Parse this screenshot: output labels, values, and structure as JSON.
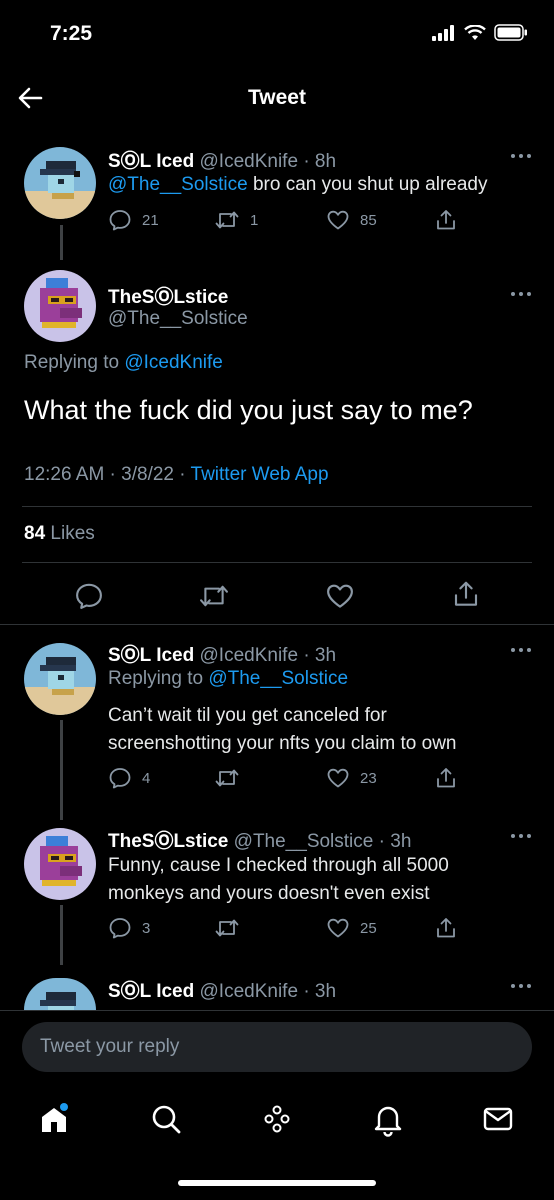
{
  "status": {
    "time": "7:25"
  },
  "header": {
    "title": "Tweet"
  },
  "tweets": [
    {
      "name": "SⓄL Iced",
      "handle": "@IcedKnife",
      "time": "· 8h",
      "mention": "@The__Solstice",
      "text": " bro can you shut up already",
      "replies": "21",
      "retweets": "1",
      "likes": "85"
    },
    {
      "name": "SⓄL Iced",
      "handle": "@IcedKnife",
      "time": "· 3h",
      "replying_label": "Replying to ",
      "replying_to": "@The__Solstice",
      "text_line1": "Can’t wait til you get canceled for",
      "text_line2": "screenshotting your nfts you claim to own",
      "replies": "4",
      "retweets": "",
      "likes": "23"
    },
    {
      "name": "TheSⓄLstice",
      "handle": "@The__Solstice",
      "time": "· 3h",
      "text_line1": "Funny, cause I checked through all 5000",
      "text_line2": "monkeys and yours doesn't even exist",
      "replies": "3",
      "retweets": "",
      "likes": "25"
    },
    {
      "name": "SⓄL Iced",
      "handle": "@IcedKnife",
      "time": "· 3h"
    }
  ],
  "main_tweet": {
    "name": "TheSⓄLstice",
    "handle": "@The__Solstice",
    "replying_label": "Replying to ",
    "replying_to": "@IcedKnife",
    "text": "What the fuck did you just say to me?",
    "timestamp": "12:26 AM · 3/8/22 · ",
    "source": "Twitter Web App",
    "likes_count": "84",
    "likes_label": " Likes"
  },
  "reply": {
    "placeholder": "Tweet your reply"
  },
  "tabbar": {
    "icons": [
      "home-icon",
      "search-icon",
      "spaces-icon",
      "notifications-icon",
      "messages-icon"
    ]
  },
  "colors": {
    "accent": "#1d9bf0",
    "background": "#000000",
    "secondary_text": "#8b98a5"
  }
}
